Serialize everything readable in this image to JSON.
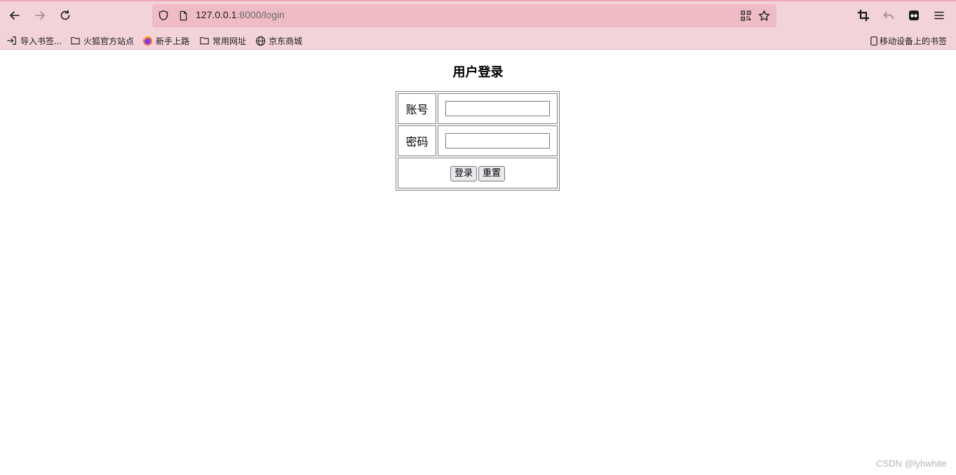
{
  "browser": {
    "url_host": "127.0.0.1",
    "url_rest": ":8000/login",
    "bookmarks": [
      {
        "label": "导入书签...",
        "icon": "import-icon"
      },
      {
        "label": "火狐官方站点",
        "icon": "folder-icon"
      },
      {
        "label": "新手上路",
        "icon": "firefox-icon"
      },
      {
        "label": "常用网址",
        "icon": "folder-icon"
      },
      {
        "label": "京东商城",
        "icon": "globe-icon"
      }
    ],
    "mobile_bookmarks": "移动设备上的书签"
  },
  "page": {
    "title": "用户登录",
    "account_label": "账号",
    "password_label": "密码",
    "account_value": "",
    "password_value": "",
    "login_button": "登录",
    "reset_button": "重置"
  },
  "watermark": "CSDN @lyhwhite"
}
